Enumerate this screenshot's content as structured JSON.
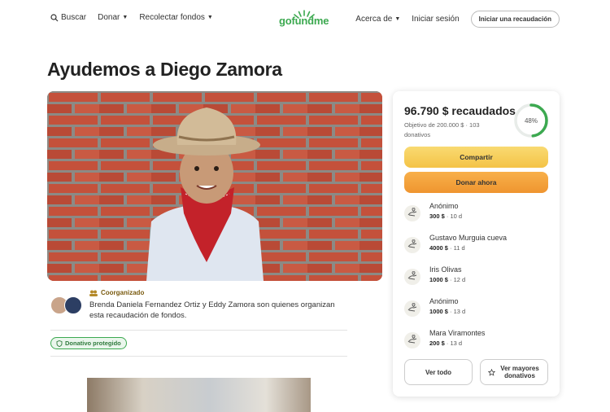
{
  "nav": {
    "search": "Buscar",
    "donate": "Donar",
    "fundraise": "Recolectar fondos",
    "logo": "gofundme",
    "about": "Acerca de",
    "login": "Iniciar sesión",
    "start": "Iniciar una recaudación"
  },
  "campaign": {
    "title": "Ayudemos a Diego Zamora",
    "organizer_label": "Coorganizado",
    "organizer_text": "Brenda Daniela Fernandez Ortiz y Eddy Zamora son quienes organizan esta recaudación de fondos.",
    "protected_badge": "Donativo protegido"
  },
  "progress": {
    "raised": "96.790 $ recaudados",
    "goal_text": "Objetivo de 200.000 $ · 103 donativos",
    "percent_label": "48%",
    "percent_value": 0.48
  },
  "actions": {
    "share": "Compartir",
    "donate": "Donar ahora",
    "see_all": "Ver todo",
    "see_top": "Ver mayores donativos"
  },
  "donations": [
    {
      "name": "Anónimo",
      "amount": "300 $",
      "time": "10 d"
    },
    {
      "name": "Gustavo Murguia cueva",
      "amount": "4000 $",
      "time": "11 d"
    },
    {
      "name": "Iris Olivas",
      "amount": "1000 $",
      "time": "12 d"
    },
    {
      "name": "Anónimo",
      "amount": "1000 $",
      "time": "13 d"
    },
    {
      "name": "Mara Viramontes",
      "amount": "200 $",
      "time": "13 d"
    }
  ],
  "colors": {
    "brand": "#3ca950",
    "share": "#f4c346",
    "donate": "#ef9530"
  }
}
